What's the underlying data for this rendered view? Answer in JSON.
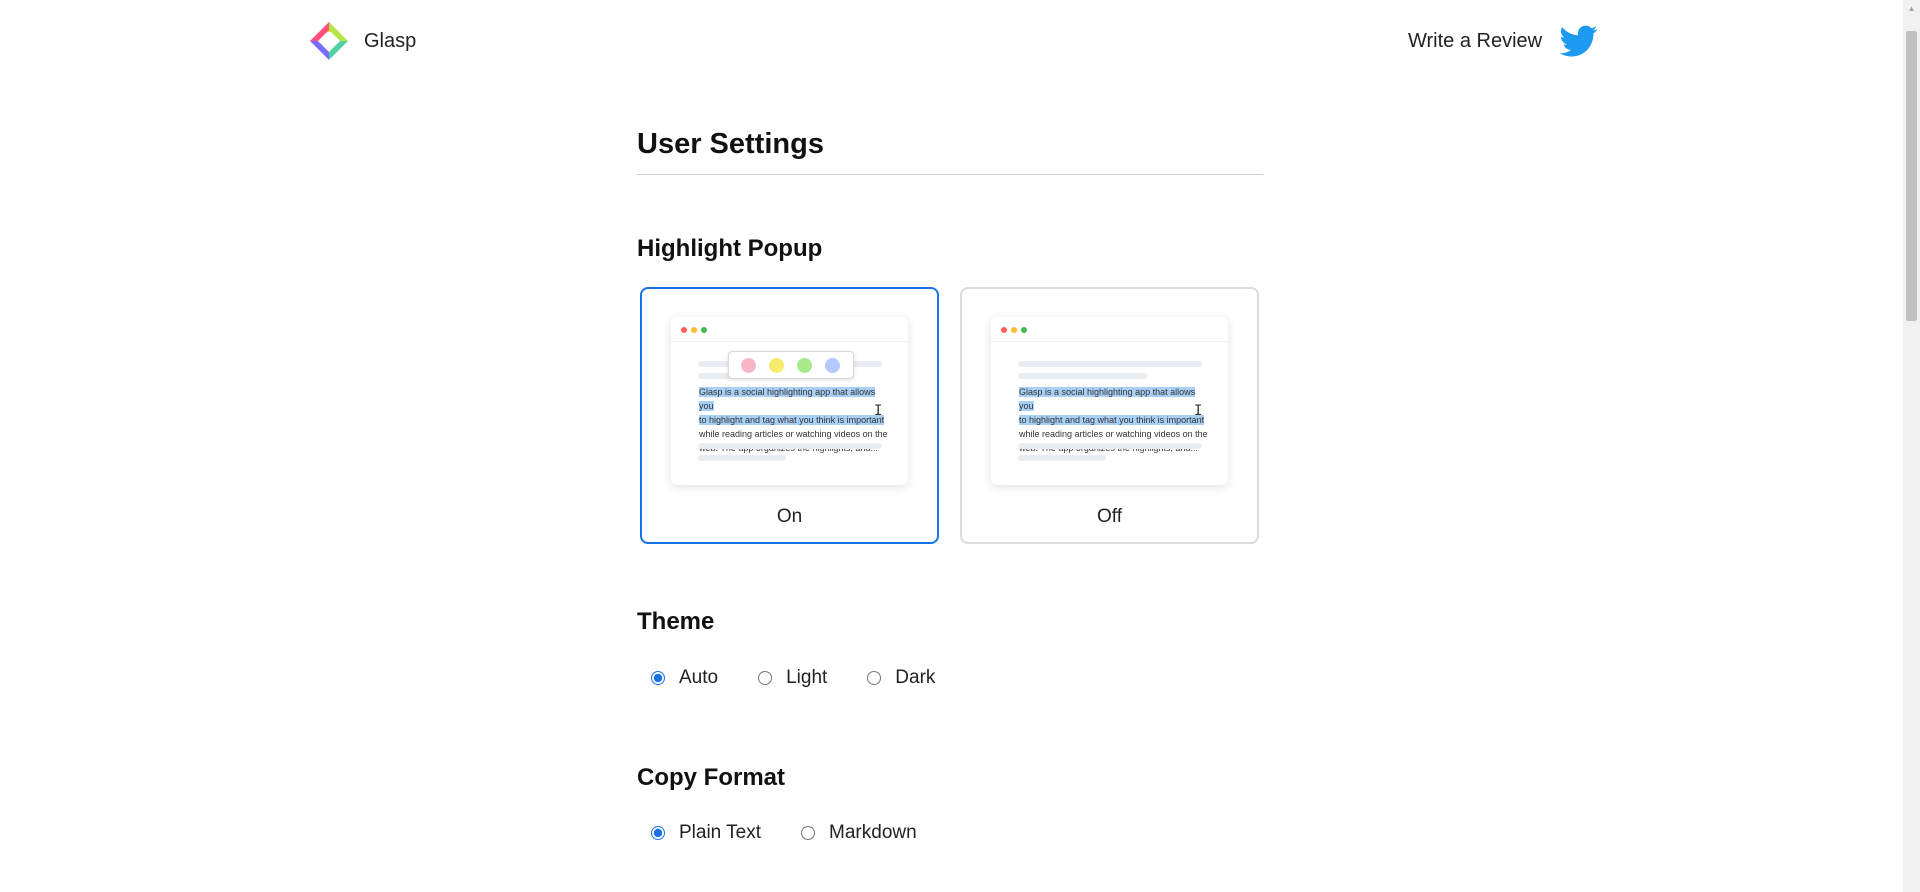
{
  "header": {
    "brand_name": "Glasp",
    "review_label": "Write a Review",
    "twitter_icon": "twitter-bird-icon"
  },
  "page": {
    "title": "User Settings"
  },
  "highlight_popup": {
    "title": "Highlight Popup",
    "selected": "On",
    "options": [
      {
        "label": "On"
      },
      {
        "label": "Off"
      }
    ],
    "preview_text_highlighted_1": "Glasp is a social highlighting app that allows you",
    "preview_text_highlighted_2": "to highlight and tag what you think is important",
    "preview_text_rest_1": "while reading articles or watching videos on the",
    "preview_text_rest_2": "web. The app organizes the highlights, and...",
    "popup_colors": [
      "#f7b7c6",
      "#f5ec6e",
      "#a6ea8a",
      "#b5c8ff"
    ]
  },
  "theme": {
    "title": "Theme",
    "options": [
      {
        "label": "Auto",
        "checked": true
      },
      {
        "label": "Light",
        "checked": false
      },
      {
        "label": "Dark",
        "checked": false
      }
    ]
  },
  "copy_format": {
    "title": "Copy Format",
    "options": [
      {
        "label": "Plain Text",
        "checked": true
      },
      {
        "label": "Markdown",
        "checked": false
      }
    ]
  },
  "colors": {
    "accent": "#1a73e8",
    "twitter": "#1d9bf0",
    "highlight": "#a8cff5"
  }
}
